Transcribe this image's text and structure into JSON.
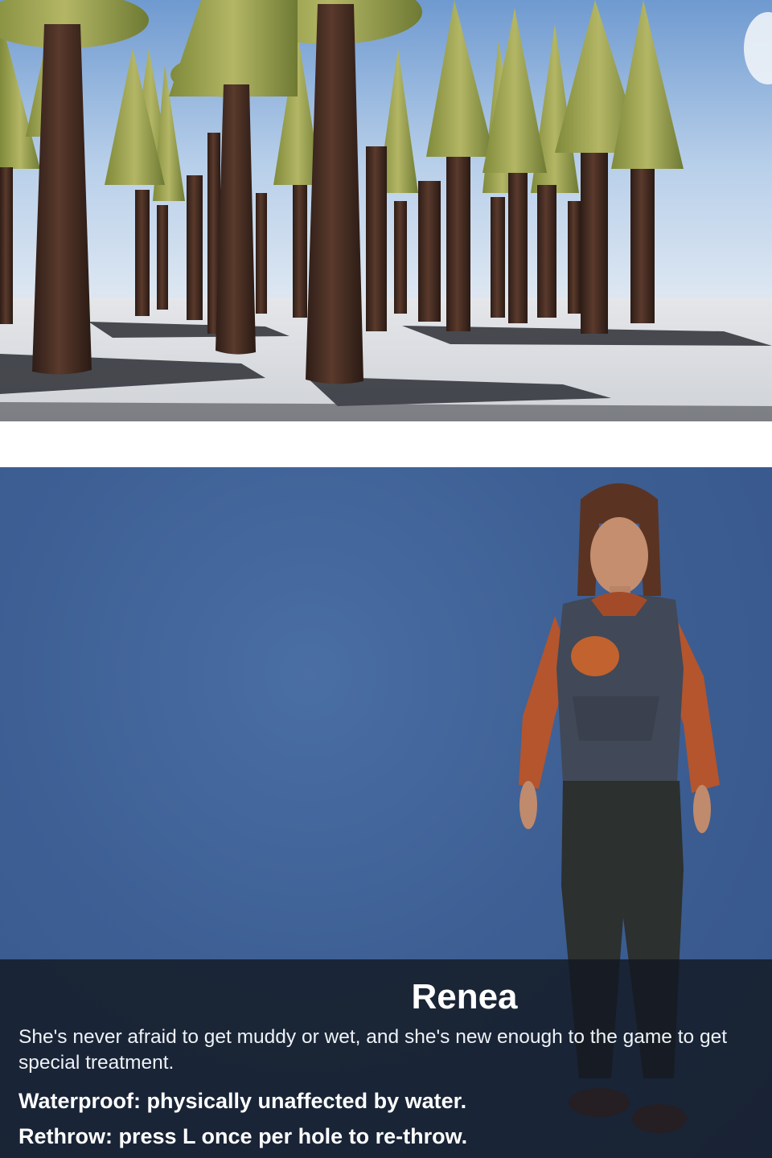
{
  "scene": {
    "sky_color": "#a9c6e8",
    "ground_color": "#d9dbde",
    "trunk_color": "#4a2f25",
    "canopy_color": "#9aa14f"
  },
  "character_select": {
    "background_color": "#3d5f94",
    "name": "Renea",
    "description": "She's never afraid to get muddy or wet, and she's new enough to the game to get special treatment.",
    "abilities": [
      "Waterproof: physically unaffected by water.",
      "Rethrow: press L once per hole to re-throw."
    ]
  }
}
